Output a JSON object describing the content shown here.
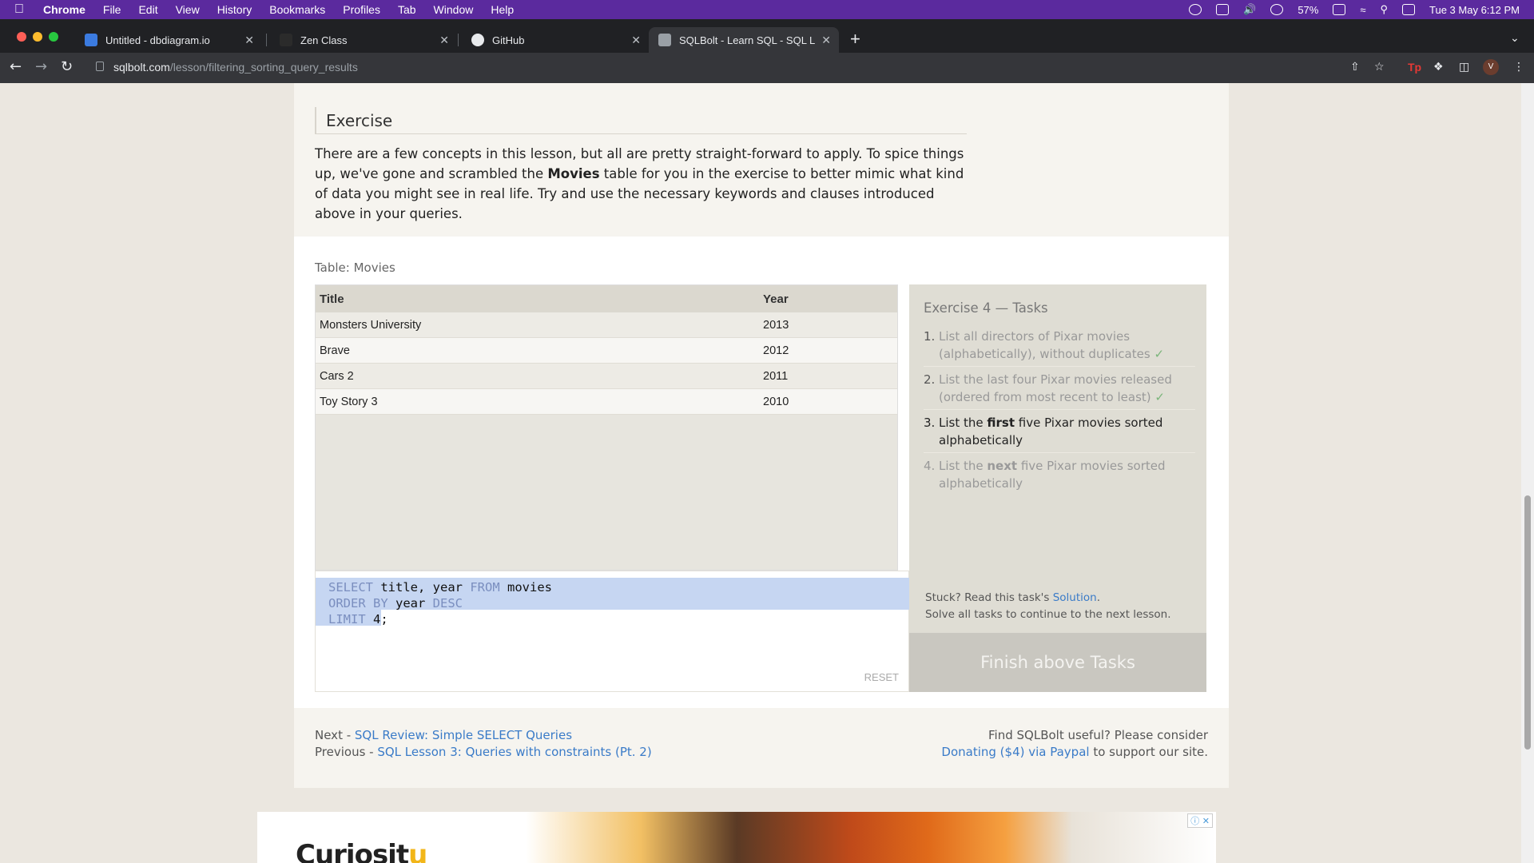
{
  "menubar": {
    "app": "Chrome",
    "items": [
      "File",
      "Edit",
      "View",
      "History",
      "Bookmarks",
      "Profiles",
      "Tab",
      "Window",
      "Help"
    ],
    "battery": "57%",
    "datetime": "Tue 3 May  6:12 PM"
  },
  "tabs": [
    {
      "title": "Untitled - dbdiagram.io"
    },
    {
      "title": "Zen Class"
    },
    {
      "title": "GitHub"
    },
    {
      "title": "SQLBolt - Learn SQL - SQL Le"
    }
  ],
  "toolbar": {
    "url_host": "sqlbolt.com",
    "url_path": "/lesson/filtering_sorting_query_results",
    "avatar_initial": "V"
  },
  "exercise": {
    "heading": "Exercise",
    "text_before": "There are a few concepts in this lesson, but all are pretty straight-forward to apply. To spice things up, we've gone and scrambled the ",
    "text_bold": "Movies",
    "text_after": " table for you in the exercise to better mimic what kind of data you might see in real life. Try and use the necessary keywords and clauses introduced above in your queries."
  },
  "result_table": {
    "caption": "Table: Movies",
    "columns": [
      "Title",
      "Year"
    ],
    "rows": [
      [
        "Monsters University",
        "2013"
      ],
      [
        "Brave",
        "2012"
      ],
      [
        "Cars 2",
        "2011"
      ],
      [
        "Toy Story 3",
        "2010"
      ]
    ]
  },
  "editor": {
    "line1_kw1": "SELECT",
    "line1_mid": " title, year ",
    "line1_kw2": "FROM",
    "line1_end": " movies",
    "line2_kw": "ORDER BY",
    "line2_mid": " year ",
    "line2_kw2": "DESC",
    "line3_kw": "LIMIT",
    "line3_end": " 4;",
    "reset_label": "RESET"
  },
  "tasks": {
    "title": "Exercise 4 — Tasks",
    "items": [
      {
        "num": "1.",
        "text": "List all directors of Pixar movies (alphabetically), without duplicates",
        "check": "✓"
      },
      {
        "num": "2.",
        "text": "List the last four Pixar movies released (ordered from most recent to least)",
        "check": "✓"
      },
      {
        "num": "3.",
        "pre": "List the ",
        "bold": "first",
        "post": " five Pixar movies sorted alphabetically"
      },
      {
        "num": "4.",
        "pre": "List the ",
        "bold": "next",
        "post": " five Pixar movies sorted alphabetically"
      }
    ],
    "stuck_text": "Stuck? Read this task's ",
    "solution_link": "Solution",
    "stuck_period": ".",
    "solve_text": "Solve all tasks to continue to the next lesson.",
    "finish_label": "Finish above Tasks"
  },
  "footer": {
    "next_label": "Next - ",
    "next_link": "SQL Review: Simple SELECT Queries",
    "prev_label": "Previous - ",
    "prev_link": "SQL Lesson 3: Queries with constraints (Pt. 2)",
    "support_line1": "Find SQLBolt useful? Please consider",
    "donate_link": "Donating ($4) via Paypal",
    "support_line2_end": " to support our site."
  },
  "ad": {
    "brand_a": "Curiosit",
    "brand_b": "u",
    "choices": "ⓘ ✕"
  },
  "colors": {
    "menubar": "#5b2a9e",
    "link": "#3a7bc8",
    "keyword": "#7a8ebf",
    "selection": "#c6d6f2",
    "check": "#7ab57a"
  }
}
